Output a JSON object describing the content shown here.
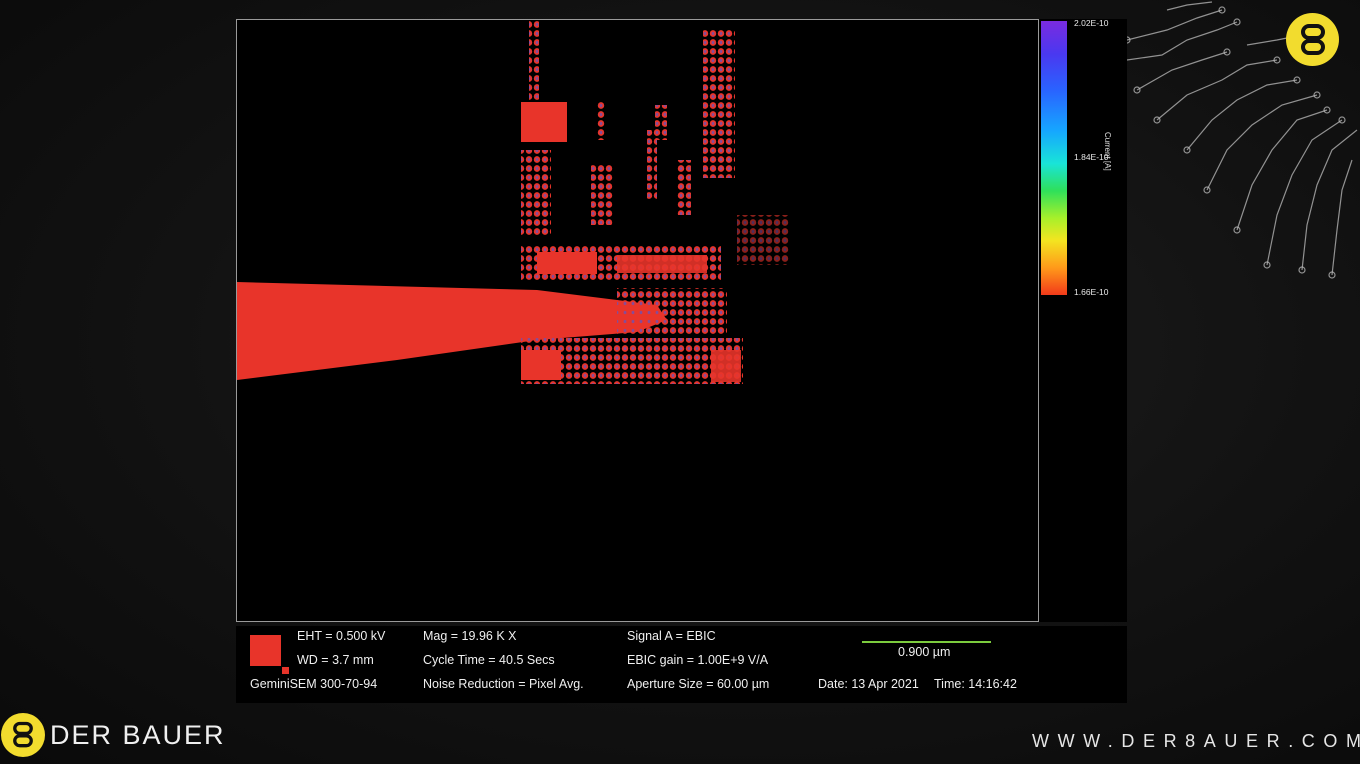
{
  "colorscale": {
    "ticks": [
      "2.02E-10",
      "1.84E-10",
      "1.66E-10"
    ],
    "unit": "Current [A]",
    "colors": [
      "#7a2be0",
      "#2a62ff",
      "#19e4d8",
      "#2fe05a",
      "#f3e520",
      "#ff9a1a",
      "#f23a1a"
    ]
  },
  "info": {
    "eht": "EHT = 0.500 kV",
    "wd": "WD =  3.7 mm",
    "model": "GeminiSEM 300-70-94",
    "mag": "Mag =    19.96 K X",
    "cycle": "Cycle Time = 40.5 Secs",
    "noise": "Noise Reduction = Pixel Avg.",
    "signal": "Signal A = EBIC",
    "gain": "EBIC gain = 1.00E+9 V/A",
    "aperture": "Aperture Size = 60.00 µm",
    "scale": "0.900 µm",
    "date": "Date: 13 Apr 2021",
    "time": "Time: 14:16:42"
  },
  "brand": {
    "name": "DER BAUER",
    "url": "WWW.DER8AUER.COM",
    "logo_glyph": "8",
    "accent": "#f2dc2e"
  },
  "image_colors": {
    "hot": "#e8342a",
    "background": "#000000"
  }
}
